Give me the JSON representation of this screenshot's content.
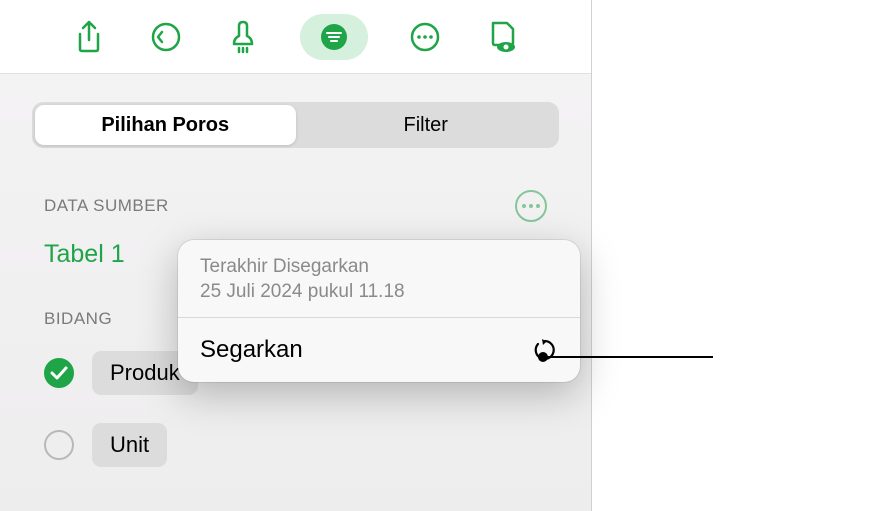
{
  "toolbar": {
    "share": "share",
    "undo": "undo",
    "brush": "brush",
    "organize": "organize",
    "more": "more",
    "document_mode": "document-mode"
  },
  "tabs": {
    "pivot": "Pilihan Poros",
    "filter": "Filter"
  },
  "source": {
    "section_label": "DATA SUMBER",
    "table_name": "Tabel 1"
  },
  "fields": {
    "section_label": "BIDANG",
    "items": [
      {
        "label": "Produk",
        "checked": true
      },
      {
        "label": "Unit",
        "checked": false
      }
    ]
  },
  "popover": {
    "last_refreshed_label": "Terakhir Disegarkan",
    "last_refreshed_date": "25 Juli 2024 pukul 11.18",
    "refresh_label": "Segarkan"
  },
  "colors": {
    "accent": "#1fa548",
    "accent_light": "#d5f0dd"
  }
}
